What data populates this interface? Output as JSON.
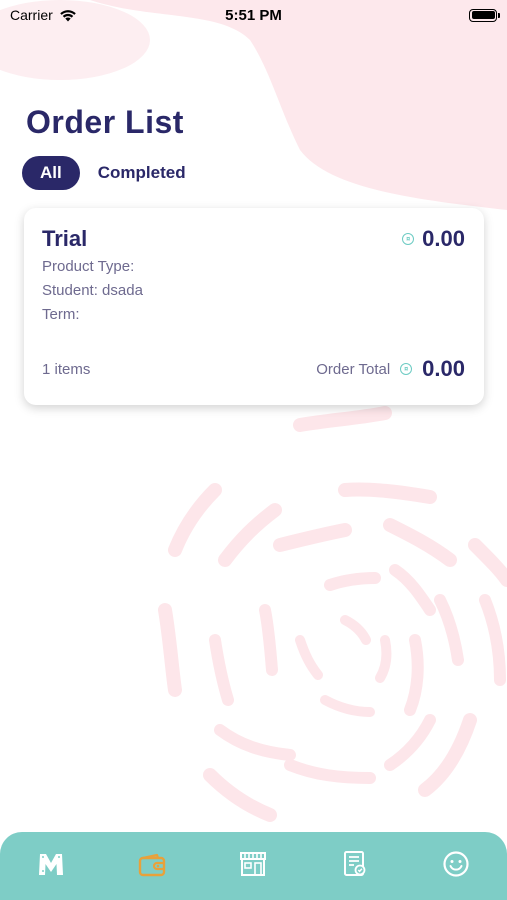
{
  "status_bar": {
    "carrier": "Carrier",
    "time": "5:51 PM"
  },
  "page": {
    "title": "Order List"
  },
  "tabs": [
    {
      "label": "All",
      "active": true
    },
    {
      "label": "Completed",
      "active": false
    }
  ],
  "order": {
    "title": "Trial",
    "price": "0.00",
    "product_type_label": "Product Type:",
    "student_label": "Student: dsada",
    "term_label": "Term:",
    "items_count": "1 items",
    "total_label": "Order Total",
    "total_value": "0.00",
    "coin_glyph": "¤"
  },
  "nav": {
    "items": [
      {
        "icon": "home-logo-icon",
        "active": false
      },
      {
        "icon": "wallet-icon",
        "active": true
      },
      {
        "icon": "store-icon",
        "active": false
      },
      {
        "icon": "report-icon",
        "active": false
      },
      {
        "icon": "smiley-icon",
        "active": false
      }
    ],
    "active_color": "#e8a13a",
    "inactive_color": "#ffffff"
  },
  "colors": {
    "primary": "#2a2868",
    "accent_teal": "#7ecdc6",
    "decor_pink": "#fde6ea"
  }
}
